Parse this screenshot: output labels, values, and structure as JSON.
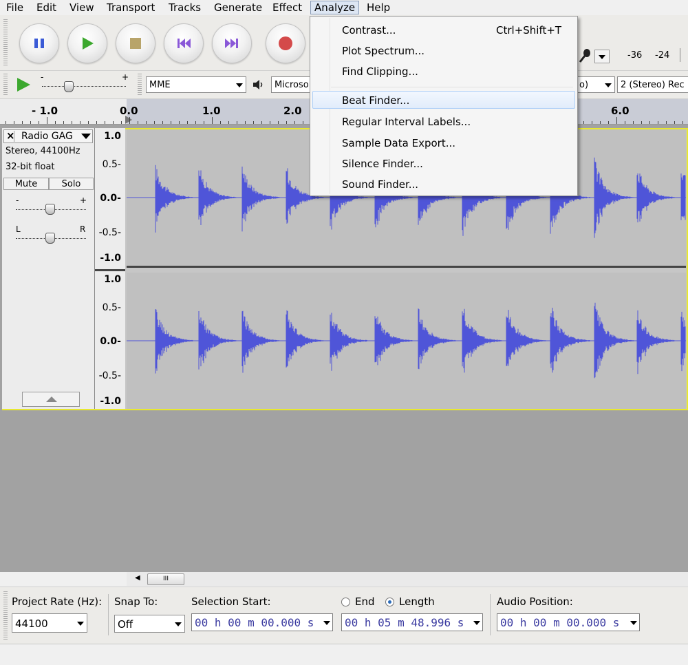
{
  "menubar": {
    "file": "File",
    "edit": "Edit",
    "view": "View",
    "transport": "Transport",
    "tracks": "Tracks",
    "generate": "Generate",
    "effect": "Effect",
    "analyze": "Analyze",
    "help": "Help"
  },
  "analyze_menu": {
    "contrast": "Contrast...",
    "contrast_shortcut": "Ctrl+Shift+T",
    "plot_spectrum": "Plot Spectrum...",
    "find_clipping": "Find Clipping...",
    "beat_finder": "Beat Finder...",
    "regular_interval_labels": "Regular Interval Labels...",
    "sample_data_export": "Sample Data Export...",
    "silence_finder": "Silence Finder...",
    "sound_finder": "Sound Finder..."
  },
  "meter": {
    "db1": "-36",
    "db2": "-24"
  },
  "device": {
    "host": "MME",
    "output_device": "Microso",
    "input_partial": "o)",
    "channels": "2 (Stereo) Rec"
  },
  "ruler": {
    "t_neg1": "- 1.0",
    "t0": "0.0",
    "t1": "1.0",
    "t2": "2.0",
    "t6": "6.0"
  },
  "track": {
    "name": "Radio GAG",
    "info1": "Stereo, 44100Hz",
    "info2": "32-bit float",
    "mute": "Mute",
    "solo": "Solo",
    "gain_minus": "-",
    "gain_plus": "+",
    "pan_left": "L",
    "pan_right": "R",
    "scale": [
      "1.0",
      "0.5-",
      "0.0-",
      "-0.5-",
      "-1.0"
    ]
  },
  "hscroll": {
    "thumb": "III"
  },
  "selection_bar": {
    "project_rate_label": "Project Rate (Hz):",
    "project_rate_value": "44100",
    "snap_label": "Snap To:",
    "snap_value": "Off",
    "selection_start_label": "Selection Start:",
    "selection_start_value": "00 h 00 m 00.000 s",
    "end_label": "End",
    "length_label": "Length",
    "length_value": "00 h 05 m 48.996 s",
    "audio_position_label": "Audio Position:",
    "audio_position_value": "00 h 00 m 00.000 s"
  },
  "colors": {
    "waveform": "#4f55d8",
    "selection_bg": "#c9ccd6",
    "track_border": "#e8e830"
  }
}
